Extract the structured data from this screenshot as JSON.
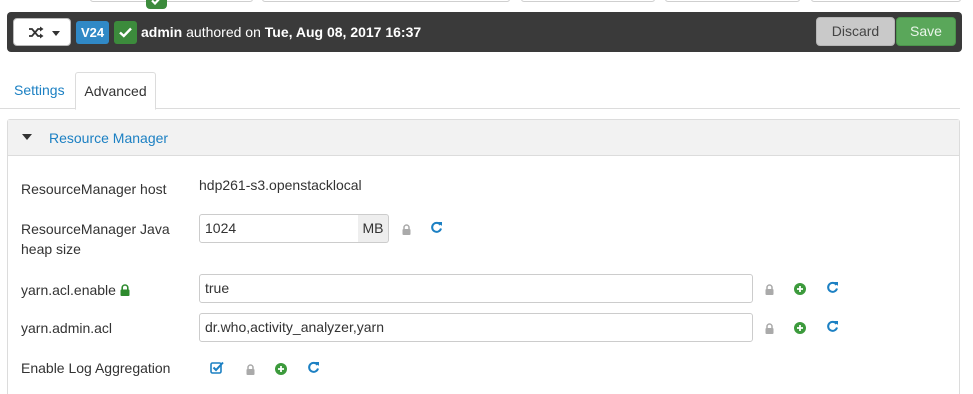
{
  "version_bar": {
    "version_badge": "V24",
    "author": "admin",
    "authored_on": "authored on",
    "date": "Tue, Aug 08, 2017 16:37",
    "discard_label": "Discard",
    "save_label": "Save"
  },
  "tabs": [
    {
      "label": "Settings",
      "active": false
    },
    {
      "label": "Advanced",
      "active": true
    }
  ],
  "section": {
    "title": "Resource Manager",
    "fields": {
      "rm_host": {
        "label": "ResourceManager host",
        "value": "hdp261-s3.openstacklocal"
      },
      "heap": {
        "label_line1": "ResourceManager Java",
        "label_line2": "heap size",
        "value": "1024",
        "unit": "MB"
      },
      "acl_enable": {
        "label": "yarn.acl.enable",
        "value": "true"
      },
      "admin_acl": {
        "label": "yarn.admin.acl",
        "value": "dr.who,activity_analyzer,yarn"
      },
      "log_agg": {
        "label": "Enable Log Aggregation",
        "checked": true
      }
    }
  },
  "icons": {
    "lock": "lock-icon",
    "add": "plus-circle-icon",
    "refresh": "refresh-icon",
    "shuffle": "shuffle-icon",
    "check": "check-icon"
  },
  "colors": {
    "link_blue": "#1c80c3",
    "green": "#3c8b3c",
    "badge_blue": "#3089c6",
    "bar_dark": "#3a3a3a"
  }
}
